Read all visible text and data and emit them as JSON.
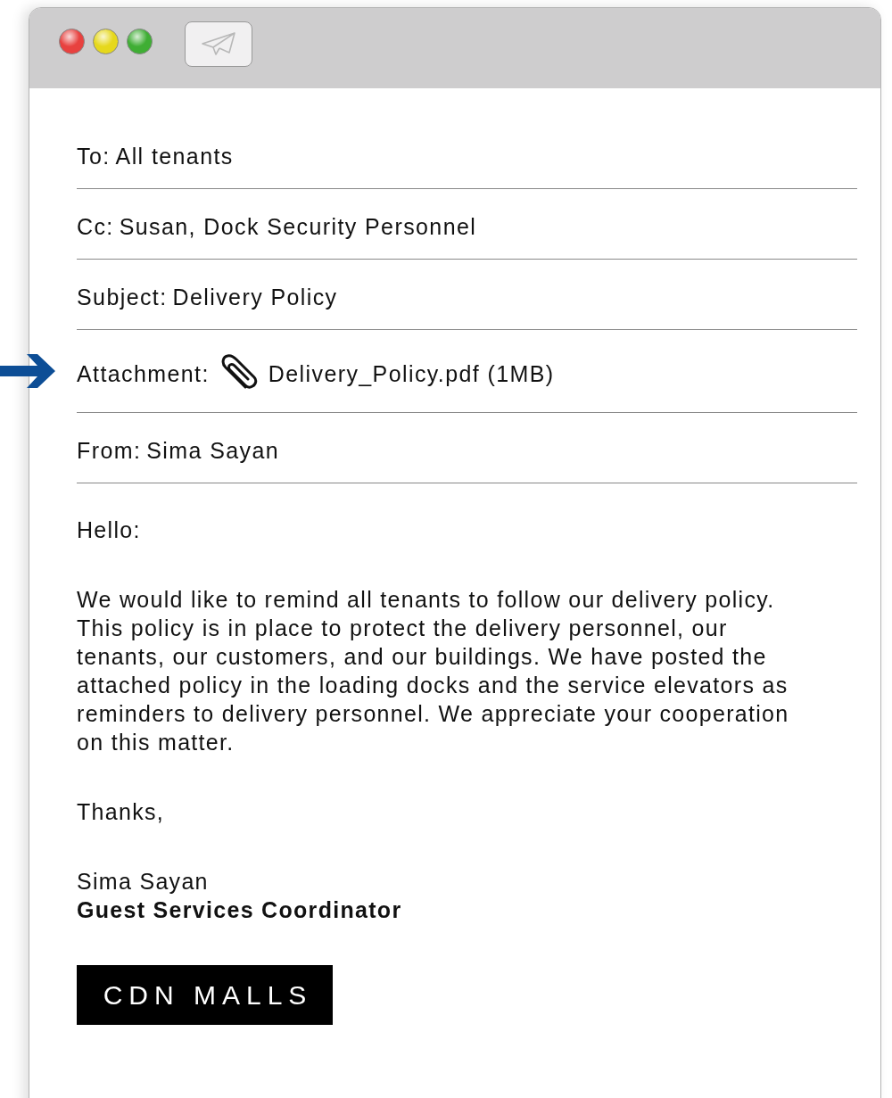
{
  "window": {
    "controls": [
      {
        "color": "#e8413f"
      },
      {
        "color": "#e6d81c"
      },
      {
        "color": "#3fae34"
      }
    ],
    "toolbar": [
      {
        "kind": "send"
      }
    ]
  },
  "headers": [
    {
      "kind": "text",
      "label": "To:",
      "value": "All tenants"
    },
    {
      "kind": "text",
      "label": "Cc:",
      "value": "Susan, Dock Security Personnel"
    },
    {
      "kind": "text",
      "label": "Subject:",
      "value": "Delivery Policy"
    },
    {
      "kind": "attachment",
      "label": "Attachment:",
      "value": "Delivery_Policy.pdf (1MB)",
      "pointer": true
    },
    {
      "kind": "text",
      "label": "From:",
      "value": "Sima Sayan"
    }
  ],
  "body": {
    "greeting": "Hello:",
    "paragraphs": [
      "We would like to remind all tenants to follow our delivery policy. This policy is in place to protect the delivery personnel, our tenants, our customers, and our buildings. We have posted the attached policy in the loading docks and the service elevators as reminders to delivery personnel. We appreciate your cooperation on this matter."
    ],
    "closing": "Thanks,"
  },
  "signature": {
    "name": "Sima Sayan",
    "title": "Guest Services Coordinator",
    "logo": "CDN MALLS"
  }
}
